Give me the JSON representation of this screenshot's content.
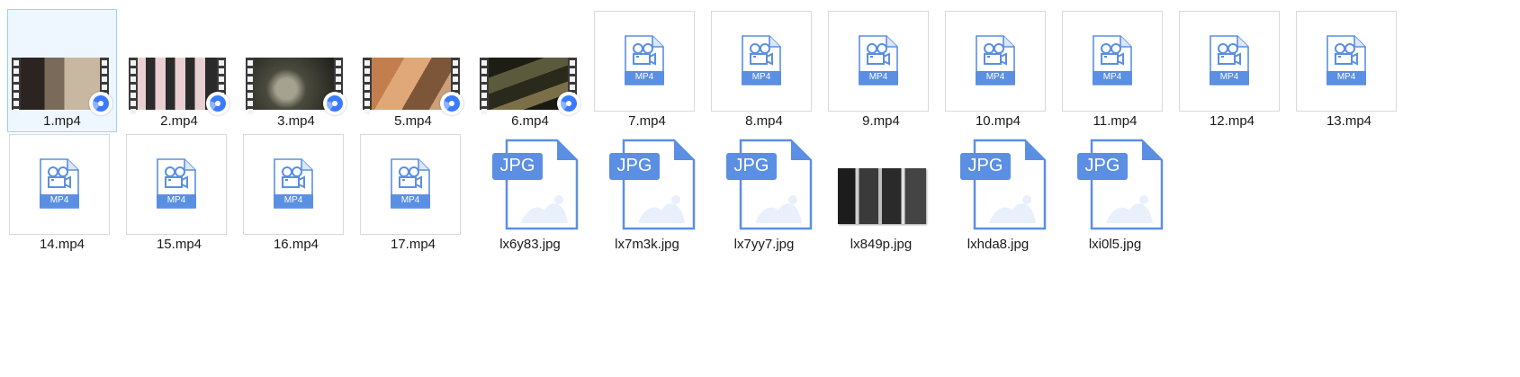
{
  "files": [
    {
      "name": "1.mp4",
      "kind": "video-thumb",
      "selected": true
    },
    {
      "name": "2.mp4",
      "kind": "video-thumb"
    },
    {
      "name": "3.mp4",
      "kind": "video-thumb"
    },
    {
      "name": "5.mp4",
      "kind": "video-thumb"
    },
    {
      "name": "6.mp4",
      "kind": "video-thumb"
    },
    {
      "name": "7.mp4",
      "kind": "mp4-icon"
    },
    {
      "name": "8.mp4",
      "kind": "mp4-icon"
    },
    {
      "name": "9.mp4",
      "kind": "mp4-icon"
    },
    {
      "name": "10.mp4",
      "kind": "mp4-icon"
    },
    {
      "name": "11.mp4",
      "kind": "mp4-icon"
    },
    {
      "name": "12.mp4",
      "kind": "mp4-icon"
    },
    {
      "name": "13.mp4",
      "kind": "mp4-icon"
    },
    {
      "name": "14.mp4",
      "kind": "mp4-icon"
    },
    {
      "name": "15.mp4",
      "kind": "mp4-icon"
    },
    {
      "name": "16.mp4",
      "kind": "mp4-icon"
    },
    {
      "name": "17.mp4",
      "kind": "mp4-icon"
    },
    {
      "name": "lx6y83.jpg",
      "kind": "jpg-icon"
    },
    {
      "name": "lx7m3k.jpg",
      "kind": "jpg-icon"
    },
    {
      "name": "lx7yy7.jpg",
      "kind": "jpg-icon"
    },
    {
      "name": "lx849p.jpg",
      "kind": "photo-thumb"
    },
    {
      "name": "lxhda8.jpg",
      "kind": "jpg-icon"
    },
    {
      "name": "lxi0l5.jpg",
      "kind": "jpg-icon"
    }
  ],
  "icon_text": {
    "mp4": "MP4",
    "jpg": "JPG"
  },
  "colors": {
    "accent": "#5b8fe3",
    "select_border": "#99d1ff",
    "select_bg": "#eef7ff",
    "badge": "#3a7bfd"
  }
}
